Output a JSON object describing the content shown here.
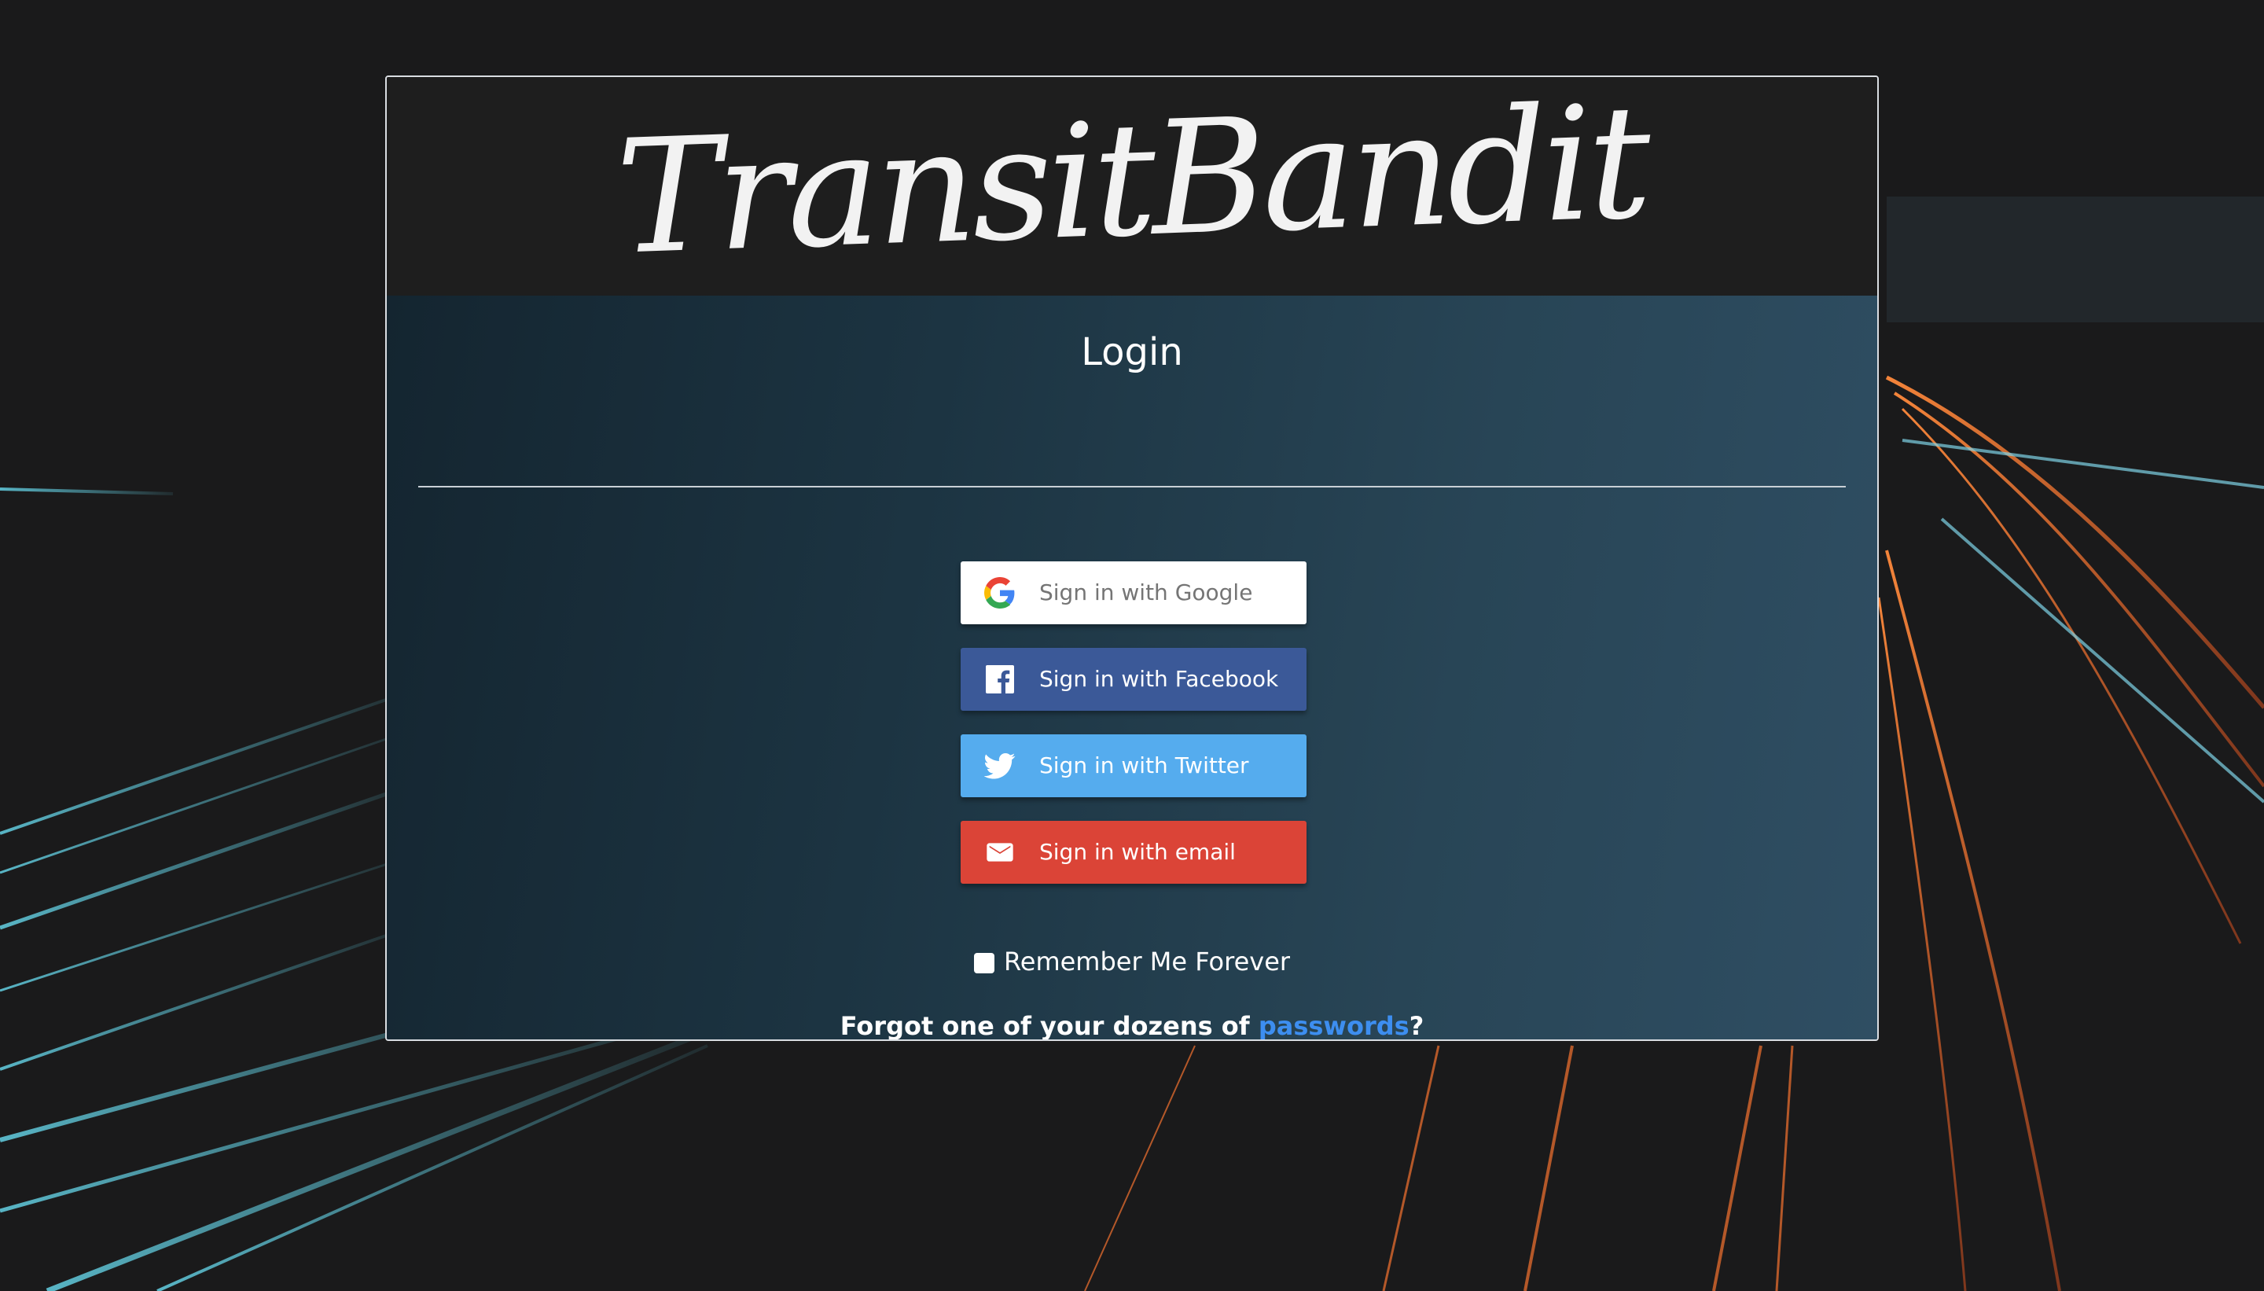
{
  "brand": {
    "logo_text": "TransitBandit"
  },
  "login": {
    "title": "Login",
    "buttons": [
      {
        "id": "google",
        "label": "Sign in with Google",
        "icon": "google-icon",
        "color": "#ffffff"
      },
      {
        "id": "facebook",
        "label": "Sign in with Facebook",
        "icon": "facebook-icon",
        "color": "#3b5998"
      },
      {
        "id": "twitter",
        "label": "Sign in with Twitter",
        "icon": "twitter-icon",
        "color": "#55acee"
      },
      {
        "id": "email",
        "label": "Sign in with email",
        "icon": "mail-icon",
        "color": "#db4437"
      }
    ],
    "remember_label": "Remember Me Forever",
    "remember_checked": false,
    "forgot_prefix": "Forgot one of your dozens of ",
    "forgot_link": "passwords",
    "forgot_suffix": "?"
  },
  "colors": {
    "link": "#3d8ef0",
    "header_bg": "#1e1e1e"
  }
}
